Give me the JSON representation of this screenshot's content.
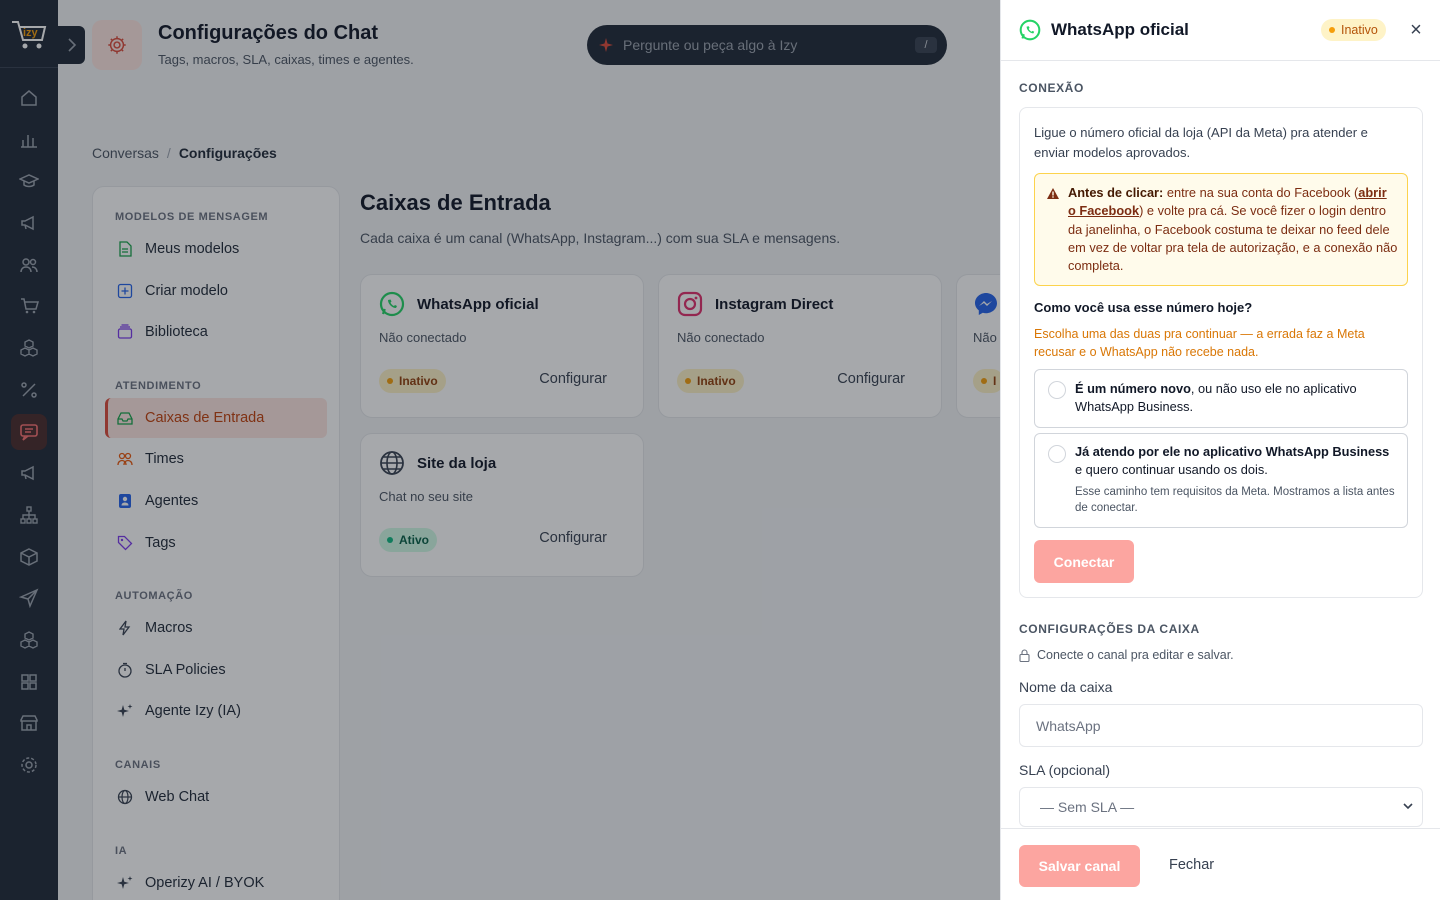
{
  "app": {
    "logo_text": "izy"
  },
  "rail": {
    "icons": [
      "home-icon",
      "chart-icon",
      "graduation-icon",
      "megaphone-icon",
      "users-icon",
      "cart-icon",
      "boxes-icon",
      "percent-icon",
      "chat-icon",
      "megaphone-icon",
      "sitemap-icon",
      "box-icon",
      "send-icon",
      "boxes-icon",
      "grid-icon",
      "store-icon",
      "gear-icon"
    ],
    "active_index": 8
  },
  "header": {
    "title": "Configurações do Chat",
    "subtitle": "Tags, macros, SLA, caixas, times e agentes."
  },
  "ask": {
    "placeholder": "Pergunte ou peça algo à Izy",
    "shortcut": "/"
  },
  "breadcrumb": {
    "root": "Conversas",
    "separator": "/",
    "current": "Configurações"
  },
  "sidebar": {
    "sections": [
      {
        "title": "MODELOS DE MENSAGEM",
        "items": [
          "Meus modelos",
          "Criar modelo",
          "Biblioteca"
        ]
      },
      {
        "title": "ATENDIMENTO",
        "items": [
          "Caixas de Entrada",
          "Times",
          "Agentes",
          "Tags"
        ]
      },
      {
        "title": "AUTOMAÇÃO",
        "items": [
          "Macros",
          "SLA Policies",
          "Agente Izy (IA)"
        ]
      },
      {
        "title": "CANAIS",
        "items": [
          "Web Chat"
        ]
      },
      {
        "title": "IA",
        "items": [
          "Operizy AI / BYOK"
        ]
      }
    ],
    "active": "Caixas de Entrada"
  },
  "main": {
    "title": "Caixas de Entrada",
    "subtitle": "Cada caixa é um canal (WhatsApp, Instagram...) com sua SLA e mensagens.",
    "cards": [
      {
        "name": "WhatsApp oficial",
        "status": "Não conectado",
        "badge": "Inativo",
        "action": "Configurar"
      },
      {
        "name": "Instagram Direct",
        "status": "Não conectado",
        "badge": "Inativo",
        "action": "Configurar"
      },
      {
        "name": "",
        "status": "Não",
        "badge": "I",
        "action": ""
      },
      {
        "name": "Site da loja",
        "status": "Chat no seu site",
        "badge": "Ativo",
        "action": "Configurar"
      }
    ]
  },
  "panel": {
    "title": "WhatsApp oficial",
    "badge": "Inativo",
    "close": "×",
    "connection_label": "CONEXÃO",
    "intro": "Ligue o número oficial da loja (API da Meta) pra atender e enviar modelos aprovados.",
    "warning": {
      "bold": "Antes de clicar:",
      "before_link": " entre na sua conta do Facebook (",
      "link": "abrir o Facebook",
      "after_link": ") e volte pra cá. Se você fizer o login dentro da janelinha, o Facebook costuma te deixar no feed dele em vez de voltar pra tela de autorização, e a conexão não completa."
    },
    "question": "Como você usa esse número hoje?",
    "question_hint": "Escolha uma das duas pra continuar — a errada faz a Meta recusar e o WhatsApp não recebe nada.",
    "option1": {
      "bold": "É um número novo",
      "rest": ", ou não uso ele no aplicativo WhatsApp Business."
    },
    "option2": {
      "bold": "Já atendo por ele no aplicativo WhatsApp Business",
      "rest": " e quero continuar usando os dois.",
      "hint": "Esse caminho tem requisitos da Meta. Mostramos a lista antes de conectar."
    },
    "connect_button": "Conectar",
    "box_settings_label": "CONFIGURAÇÕES DA CAIXA",
    "lock_note": "Conecte o canal pra editar e salvar.",
    "name_label": "Nome da caixa",
    "name_value": "WhatsApp",
    "sla_label": "SLA (opcional)",
    "sla_value": "— Sem SLA —",
    "save_button": "Salvar canal",
    "close_button": "Fechar"
  },
  "colors": {
    "accent": "#dc4b3a",
    "rail": "#1f2937",
    "whatsapp": "#25d366",
    "instagram": "#e1306c",
    "warning_bg": "#fffbeb"
  }
}
